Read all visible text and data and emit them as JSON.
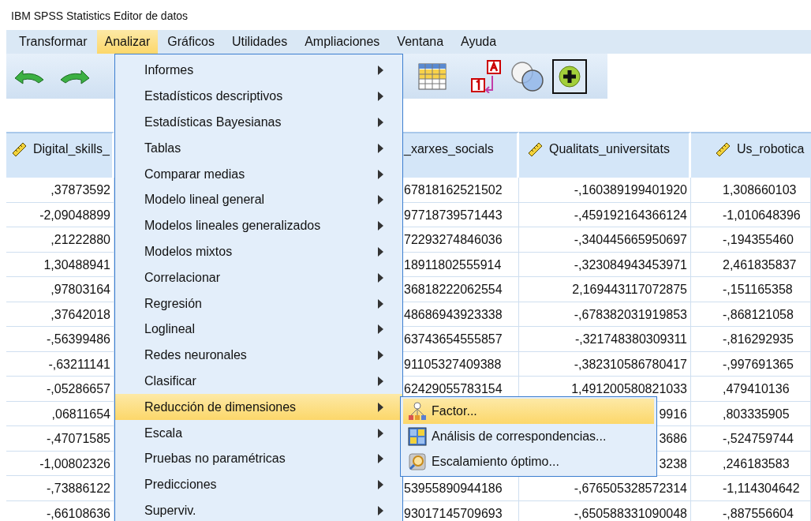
{
  "window": {
    "title": "IBM SPSS Statistics Editor de datos"
  },
  "menu_bar": [
    {
      "label": "Transformar",
      "selected": false
    },
    {
      "label": "Analizar",
      "selected": true
    },
    {
      "label": "Gráficos",
      "selected": false
    },
    {
      "label": "Utilidades",
      "selected": false
    },
    {
      "label": "Ampliaciones",
      "selected": false
    },
    {
      "label": "Ventana",
      "selected": false
    },
    {
      "label": "Ayuda",
      "selected": false
    }
  ],
  "table": {
    "columns": [
      "Digital_skills_",
      "_xarxes_socials",
      "Qualitats_universitats",
      "Us_robotica"
    ],
    "rows": [
      {
        "column_1": ",37873592",
        "column_2": "67818162521502",
        "column_3": "-,160389199401920",
        "column_4": "1,308660103"
      },
      {
        "column_1": "-2,09048899",
        "column_2": "97718739571443",
        "column_3": "-,459192164366124",
        "column_4": "-1,010648396"
      },
      {
        "column_1": ",21222880",
        "column_2": "72293274846036",
        "column_3": "-,340445665950697",
        "column_4": "-,194355460"
      },
      {
        "column_1": "1,30488941",
        "column_2": "18911802555914",
        "column_3": "-,323084943453971",
        "column_4": "2,461835837"
      },
      {
        "column_1": ",97803164",
        "column_2": "36818222062554",
        "column_3": "2,169443117072875",
        "column_4": "-,151165358"
      },
      {
        "column_1": ",37642018",
        "column_2": "48686943923338",
        "column_3": "-,678382031919853",
        "column_4": "-,868121058"
      },
      {
        "column_1": "-,56399486",
        "column_2": "63743654555857",
        "column_3": "-,321748380309311",
        "column_4": "-,816292935"
      },
      {
        "column_1": "-,63211141",
        "column_2": "91105327409388",
        "column_3": "-,382310586780417",
        "column_4": "-,997691365"
      },
      {
        "column_1": "-,05286657",
        "column_2": "62429055783154",
        "column_3": "1,491200580821033",
        "column_4": ",479410136"
      },
      {
        "column_1": ",06811654",
        "column_3": "9916",
        "column_4": ",803335905"
      },
      {
        "column_1": "-,47071585",
        "column_3": "3686",
        "column_4": "-,524759744"
      },
      {
        "column_1": "-1,00802326",
        "column_3": "3238",
        "column_4": ",246183583"
      },
      {
        "column_1": "-,73886122",
        "column_2": "53955890944186",
        "column_3": "-,676505328572314",
        "column_4": "-1,114304642"
      },
      {
        "column_1": "-,66108636",
        "column_2": "93017145709693",
        "column_3": "-,650588331090048",
        "column_4": "-,887556604"
      }
    ]
  },
  "analyze_menu": [
    {
      "label": "Informes",
      "selected": false
    },
    {
      "label": "Estadísticos descriptivos",
      "selected": false
    },
    {
      "label": "Estadísticas Bayesianas",
      "selected": false
    },
    {
      "label": "Tablas",
      "selected": false
    },
    {
      "label": "Comparar medias",
      "selected": false
    },
    {
      "label": "Modelo lineal general",
      "selected": false
    },
    {
      "label": "Modelos lineales generalizados",
      "selected": false
    },
    {
      "label": "Modelos mixtos",
      "selected": false
    },
    {
      "label": "Correlacionar",
      "selected": false
    },
    {
      "label": "Regresión",
      "selected": false
    },
    {
      "label": "Loglineal",
      "selected": false
    },
    {
      "label": "Redes neuronales",
      "selected": false
    },
    {
      "label": "Clasificar",
      "selected": false
    },
    {
      "label": "Reducción de dimensiones",
      "selected": true
    },
    {
      "label": "Escala",
      "selected": false
    },
    {
      "label": "Pruebas no paramétricas",
      "selected": false
    },
    {
      "label": "Predicciones",
      "selected": false
    },
    {
      "label": "Superviv.",
      "selected": false
    }
  ],
  "submenu": [
    {
      "label": "Factor...",
      "selected": true,
      "kind": "factor"
    },
    {
      "label": "Análisis de correspondencias...",
      "selected": false,
      "kind": "correspondence"
    },
    {
      "label": "Escalamiento óptimo...",
      "selected": false,
      "kind": "optimal"
    }
  ]
}
